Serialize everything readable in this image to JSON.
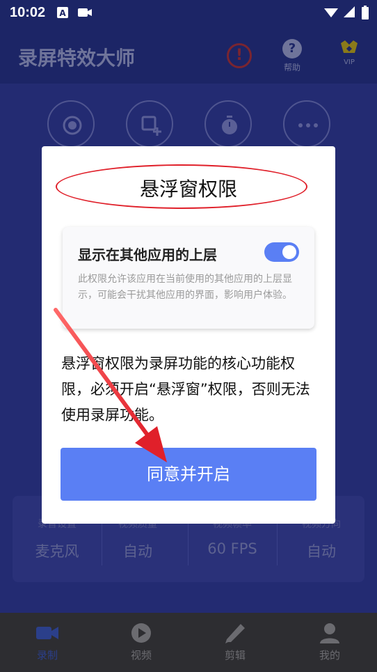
{
  "status_bar": {
    "time": "10:02"
  },
  "app": {
    "title": "录屏特效大师",
    "help_label": "帮助",
    "vip_label": "VIP",
    "alert_glyph": "!",
    "help_glyph": "?"
  },
  "settings": [
    {
      "label": "录音设置",
      "value": "麦克风"
    },
    {
      "label": "视频质量",
      "value": "自动"
    },
    {
      "label": "视频帧率",
      "value": "60 FPS"
    },
    {
      "label": "视频方向",
      "value": "自动"
    }
  ],
  "nav": [
    {
      "label": "录制",
      "icon": "video-camera-icon",
      "active": true
    },
    {
      "label": "视频",
      "icon": "play-icon",
      "active": false
    },
    {
      "label": "剪辑",
      "icon": "pencil-icon",
      "active": false
    },
    {
      "label": "我的",
      "icon": "person-icon",
      "active": false
    }
  ],
  "dialog": {
    "title": "悬浮窗权限",
    "permission_title": "显示在其他应用的上层",
    "permission_toggle_on": true,
    "permission_desc": "此权限允许该应用在当前使用的其他应用的上层显示，可能会干扰其他应用的界面，影响用户体验。",
    "body": "悬浮窗权限为录屏功能的核心功能权限，必须开启“悬浮窗”权限，否则无法使用录屏功能。",
    "agree_button": "同意并开启"
  },
  "colors": {
    "accent": "#5a7ff4",
    "annotation_red": "#e0202a",
    "header_bg": "#1c2566"
  }
}
